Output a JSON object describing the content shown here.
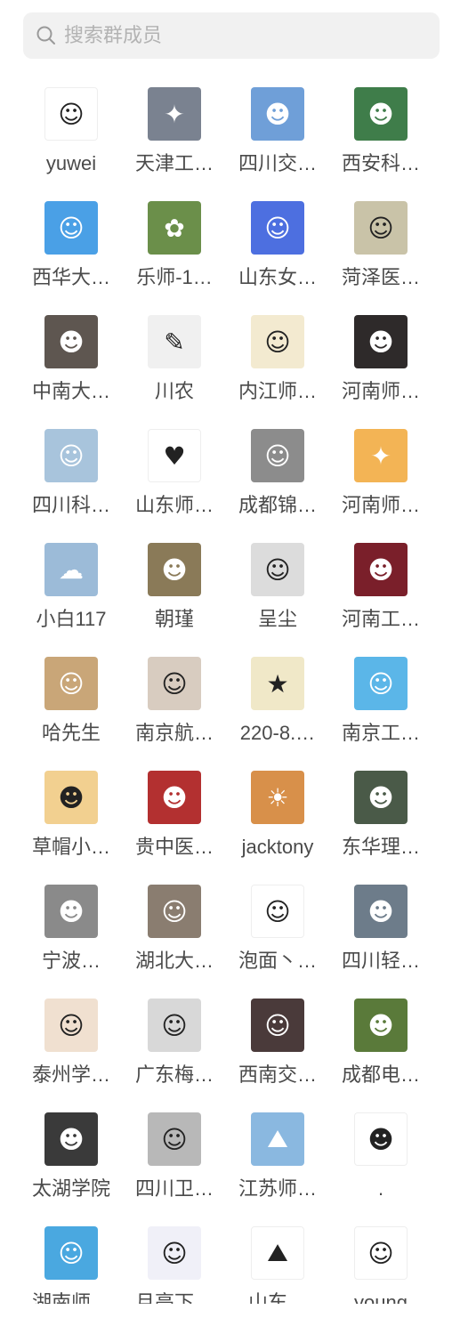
{
  "search": {
    "placeholder": "搜索群成员",
    "icon": "search-icon"
  },
  "members": [
    {
      "name": "yuwei",
      "color": "#ffffff",
      "glyph": "☺"
    },
    {
      "name": "天津工…",
      "color": "#7a8290",
      "glyph": "✦"
    },
    {
      "name": "四川交…",
      "color": "#6f9fd8",
      "glyph": "☻"
    },
    {
      "name": "西安科…",
      "color": "#3f7d4a",
      "glyph": "☻"
    },
    {
      "name": "西华大…",
      "color": "#4aa0e6",
      "glyph": "☺"
    },
    {
      "name": "乐师-1…",
      "color": "#6b8f4a",
      "glyph": "✿"
    },
    {
      "name": "山东女…",
      "color": "#4d6fe0",
      "glyph": "☺"
    },
    {
      "name": "菏泽医…",
      "color": "#c9c3a8",
      "glyph": "☺"
    },
    {
      "name": "中南大…",
      "color": "#5e5650",
      "glyph": "☻"
    },
    {
      "name": "川农",
      "color": "#f0f0f0",
      "glyph": "✎"
    },
    {
      "name": "内江师…",
      "color": "#f3ead0",
      "glyph": "☺"
    },
    {
      "name": "河南师…",
      "color": "#2e2a2a",
      "glyph": "☻"
    },
    {
      "name": "四川科…",
      "color": "#a8c4dc",
      "glyph": "☺"
    },
    {
      "name": "山东师…",
      "color": "#ffffff",
      "glyph": "♥"
    },
    {
      "name": "成都锦…",
      "color": "#8c8c8c",
      "glyph": "☺"
    },
    {
      "name": "河南师…",
      "color": "#f3b455",
      "glyph": "✦"
    },
    {
      "name": "小白117",
      "color": "#9cbbd8",
      "glyph": "☁"
    },
    {
      "name": "朝瑾",
      "color": "#8a7a58",
      "glyph": "☻"
    },
    {
      "name": "呈尘",
      "color": "#dcdcdc",
      "glyph": "☺"
    },
    {
      "name": "河南工…",
      "color": "#7a1f2a",
      "glyph": "☻"
    },
    {
      "name": "哈先生",
      "color": "#c9a678",
      "glyph": "☺"
    },
    {
      "name": "南京航…",
      "color": "#d8ccc0",
      "glyph": "☺"
    },
    {
      "name": "220-8.…",
      "color": "#f0e8c8",
      "glyph": "★"
    },
    {
      "name": "南京工…",
      "color": "#5bb6e8",
      "glyph": "☺"
    },
    {
      "name": "草帽小…",
      "color": "#f2d090",
      "glyph": "☻"
    },
    {
      "name": "贵中医…",
      "color": "#b33030",
      "glyph": "☻"
    },
    {
      "name": "jacktony",
      "color": "#d8904a",
      "glyph": "☀"
    },
    {
      "name": "东华理…",
      "color": "#4a5a48",
      "glyph": "☻"
    },
    {
      "name": "宁波…",
      "color": "#8a8a8a",
      "glyph": "☻"
    },
    {
      "name": "湖北大…",
      "color": "#8a7d70",
      "glyph": "☺"
    },
    {
      "name": "泡面丶…",
      "color": "#ffffff",
      "glyph": "☺"
    },
    {
      "name": "四川轻…",
      "color": "#6d7c8a",
      "glyph": "☻"
    },
    {
      "name": "泰州学…",
      "color": "#f0e0d0",
      "glyph": "☺"
    },
    {
      "name": "广东梅…",
      "color": "#d8d8d8",
      "glyph": "☺"
    },
    {
      "name": "西南交…",
      "color": "#4a3a3a",
      "glyph": "☺"
    },
    {
      "name": "成都电…",
      "color": "#5a7a3a",
      "glyph": "☻"
    },
    {
      "name": "太湖学院",
      "color": "#3a3a3a",
      "glyph": "☻"
    },
    {
      "name": "四川卫…",
      "color": "#b8b8b8",
      "glyph": "☺"
    },
    {
      "name": "江苏师…",
      "color": "#8ab8e0",
      "glyph": "⛰"
    },
    {
      "name": ".",
      "color": "#ffffff",
      "glyph": "☻"
    },
    {
      "name": "湖南师…",
      "color": "#4aa8e0",
      "glyph": "☺"
    },
    {
      "name": "月亮下…",
      "color": "#f0f0f8",
      "glyph": "☺"
    },
    {
      "name": "山东…",
      "color": "#ffffff",
      "glyph": "⛰"
    },
    {
      "name": "young",
      "color": "#ffffff",
      "glyph": "☺"
    }
  ]
}
